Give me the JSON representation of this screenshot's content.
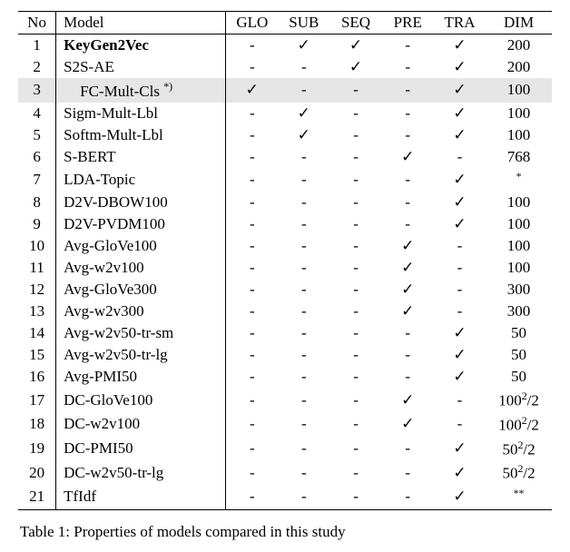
{
  "headers": {
    "no": "No",
    "model": "Model",
    "glo": "GLO",
    "sub": "SUB",
    "seq": "SEQ",
    "pre": "PRE",
    "tra": "TRA",
    "dim": "DIM"
  },
  "check": "✓",
  "dash": "-",
  "rows": [
    {
      "no": "1",
      "model": "KeyGen2Vec",
      "bold": true,
      "glo": "-",
      "sub": "✓",
      "seq": "✓",
      "pre": "-",
      "tra": "✓",
      "dim": "200"
    },
    {
      "no": "2",
      "model": "S2S-AE",
      "glo": "-",
      "sub": "-",
      "seq": "✓",
      "pre": "-",
      "tra": "✓",
      "dim": "200"
    },
    {
      "no": "3",
      "model": "FC-Mult-Cls",
      "indent": true,
      "note": "*)",
      "highlight": true,
      "glo": "✓",
      "sub": "-",
      "seq": "-",
      "pre": "-",
      "tra": "✓",
      "dim": "100"
    },
    {
      "no": "4",
      "model": "Sigm-Mult-Lbl",
      "glo": "-",
      "sub": "✓",
      "seq": "-",
      "pre": "-",
      "tra": "✓",
      "dim": "100"
    },
    {
      "no": "5",
      "model": "Softm-Mult-Lbl",
      "glo": "-",
      "sub": "✓",
      "seq": "-",
      "pre": "-",
      "tra": "✓",
      "dim": "100"
    },
    {
      "no": "6",
      "model": "S-BERT",
      "glo": "-",
      "sub": "-",
      "seq": "-",
      "pre": "✓",
      "tra": "-",
      "dim": "768"
    },
    {
      "no": "7",
      "model": "LDA-Topic",
      "glo": "-",
      "sub": "-",
      "seq": "-",
      "pre": "-",
      "tra": "✓",
      "dim": "*",
      "dimSup": true
    },
    {
      "no": "8",
      "model": "D2V-DBOW100",
      "glo": "-",
      "sub": "-",
      "seq": "-",
      "pre": "-",
      "tra": "✓",
      "dim": "100"
    },
    {
      "no": "9",
      "model": "D2V-PVDM100",
      "glo": "-",
      "sub": "-",
      "seq": "-",
      "pre": "-",
      "tra": "✓",
      "dim": "100"
    },
    {
      "no": "10",
      "model": "Avg-GloVe100",
      "glo": "-",
      "sub": "-",
      "seq": "-",
      "pre": "✓",
      "tra": "-",
      "dim": "100"
    },
    {
      "no": "11",
      "model": "Avg-w2v100",
      "glo": "-",
      "sub": "-",
      "seq": "-",
      "pre": "✓",
      "tra": "-",
      "dim": "100"
    },
    {
      "no": "12",
      "model": "Avg-GloVe300",
      "glo": "-",
      "sub": "-",
      "seq": "-",
      "pre": "✓",
      "tra": "-",
      "dim": "300"
    },
    {
      "no": "13",
      "model": "Avg-w2v300",
      "glo": "-",
      "sub": "-",
      "seq": "-",
      "pre": "✓",
      "tra": "-",
      "dim": "300"
    },
    {
      "no": "14",
      "model": "Avg-w2v50-tr-sm",
      "glo": "-",
      "sub": "-",
      "seq": "-",
      "pre": "-",
      "tra": "✓",
      "dim": "50"
    },
    {
      "no": "15",
      "model": "Avg-w2v50-tr-lg",
      "glo": "-",
      "sub": "-",
      "seq": "-",
      "pre": "-",
      "tra": "✓",
      "dim": "50"
    },
    {
      "no": "16",
      "model": "Avg-PMI50",
      "glo": "-",
      "sub": "-",
      "seq": "-",
      "pre": "-",
      "tra": "✓",
      "dim": "50"
    },
    {
      "no": "17",
      "model": "DC-GloVe100",
      "glo": "-",
      "sub": "-",
      "seq": "-",
      "pre": "✓",
      "tra": "-",
      "dim": "100",
      "dimSq2": true
    },
    {
      "no": "18",
      "model": "DC-w2v100",
      "glo": "-",
      "sub": "-",
      "seq": "-",
      "pre": "✓",
      "tra": "-",
      "dim": "100",
      "dimSq2": true
    },
    {
      "no": "19",
      "model": "DC-PMI50",
      "glo": "-",
      "sub": "-",
      "seq": "-",
      "pre": "-",
      "tra": "✓",
      "dim": "50",
      "dimSq2": true
    },
    {
      "no": "20",
      "model": "DC-w2v50-tr-lg",
      "glo": "-",
      "sub": "-",
      "seq": "-",
      "pre": "-",
      "tra": "✓",
      "dim": "50",
      "dimSq2": true
    },
    {
      "no": "21",
      "model": "TfIdf",
      "glo": "-",
      "sub": "-",
      "seq": "-",
      "pre": "-",
      "tra": "✓",
      "dim": "**",
      "dimSup": true
    }
  ],
  "caption_fragment": "Table 1: Properties of models compared in this study"
}
